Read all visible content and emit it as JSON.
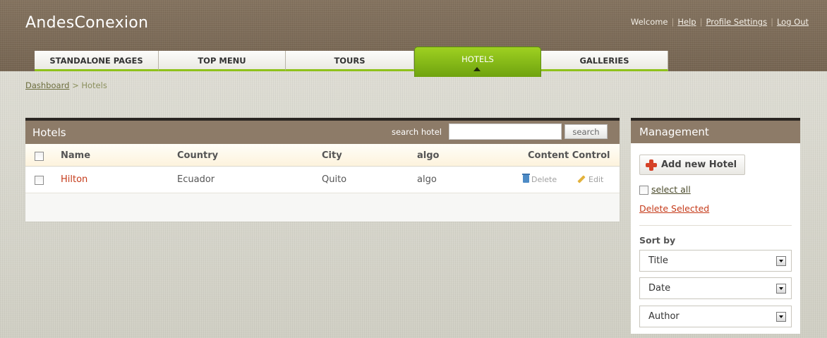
{
  "app": {
    "logo": "AndesConexion",
    "welcome": "Welcome",
    "separator": "|",
    "links": [
      "Help",
      "Profile Settings",
      "Log Out"
    ]
  },
  "nav": {
    "tabs": [
      {
        "label": "STANDALONE PAGES",
        "active": false
      },
      {
        "label": "TOP MENU",
        "active": false
      },
      {
        "label": "TOURS",
        "active": false
      },
      {
        "label": "HOTELS",
        "active": true
      },
      {
        "label": "GALLERIES",
        "active": false
      }
    ]
  },
  "breadcrumb": {
    "root": "Dashboard",
    "separator": ">",
    "current": "Hotels"
  },
  "hotels_panel": {
    "title": "Hotels",
    "search_label": "search hotel",
    "search_value": "",
    "search_button": "search",
    "columns": [
      "Name",
      "Country",
      "City",
      "algo",
      "Content Control"
    ],
    "rows": [
      {
        "name": "Hilton",
        "country": "Ecuador",
        "city": "Quito",
        "algo": "algo",
        "delete_label": "Delete",
        "edit_label": "Edit"
      }
    ]
  },
  "management": {
    "title": "Management",
    "add_button": "Add new Hotel",
    "select_all": "select all",
    "delete_selected": "Delete Selected",
    "sort_label": "Sort by",
    "sort_selects": [
      "Title",
      "Date",
      "Author"
    ]
  },
  "colors": {
    "header_brown": "#7c6b58",
    "panel_head": "#8d7b68",
    "active_tab_green": "#8fc21b",
    "name_link_red": "#c53b1a"
  }
}
